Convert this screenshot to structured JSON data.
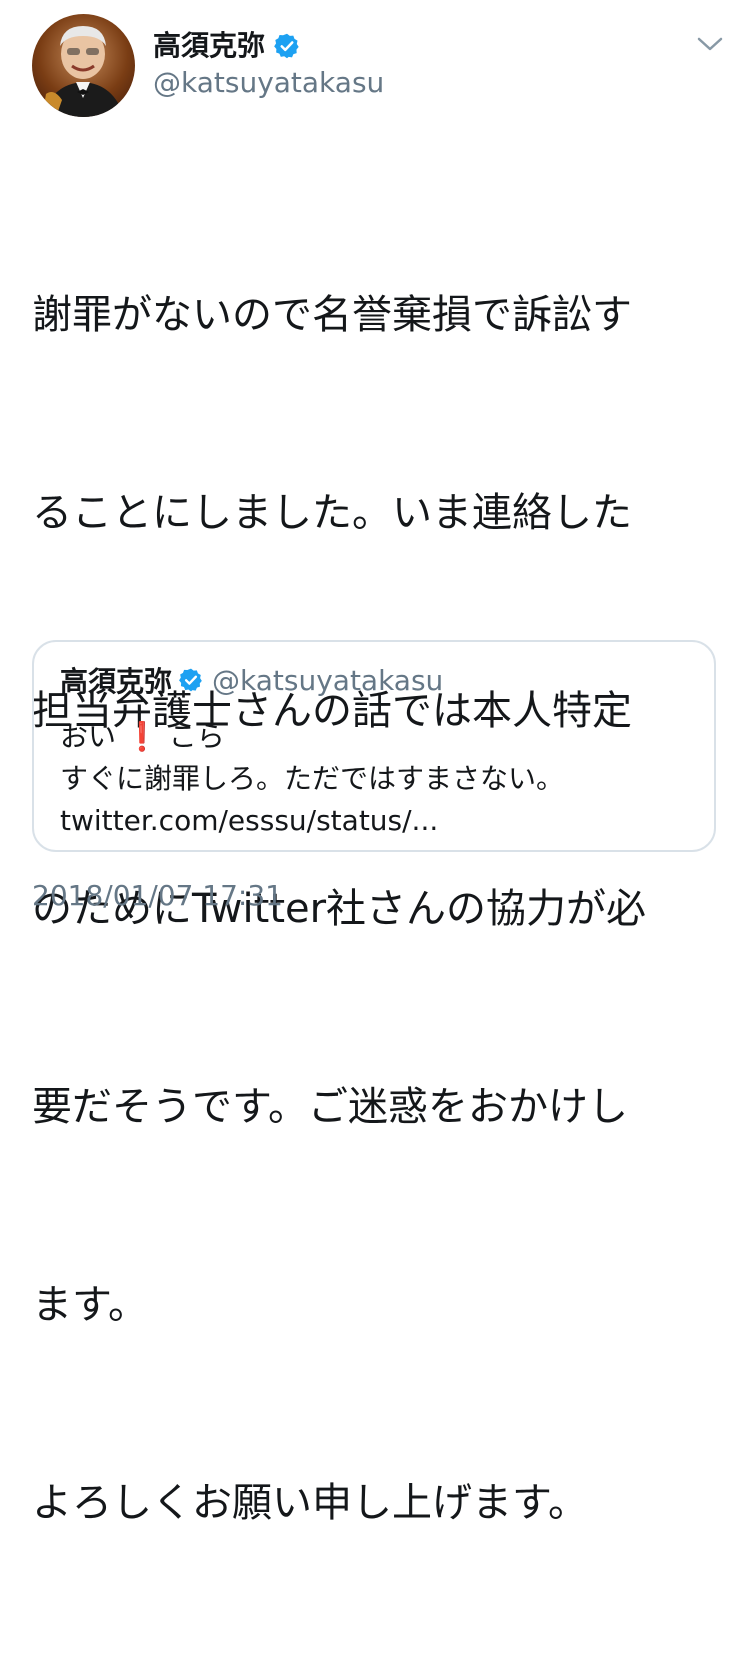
{
  "author": {
    "name": "高須克弥",
    "handle": "@katsuyatakasu",
    "verified": true
  },
  "tweet": {
    "lines": [
      "謝罪がないので名誉棄損で訴訟す",
      "ることにしました。いま連絡した",
      "担当弁護士さんの話では本人特定",
      "のためにTwitter社さんの協力が必",
      "要だそうです。ご迷惑をおかけし",
      "ます。",
      "よろしくお願い申し上げます。"
    ],
    "timestamp": "2018/01/07 17:31"
  },
  "quoted_tweet": {
    "name": "高須克弥",
    "handle": "@katsuyatakasu",
    "line1_start": "おい",
    "line1_emoji": "❗",
    "line1_end": "こら",
    "line2": "すぐに謝罪しろ。ただではすまさない。",
    "line3": "twitter.com/esssu/status/..."
  },
  "icons": {
    "verified": "verified-badge-icon",
    "menu": "chevron-down-icon",
    "avatar": "profile-avatar"
  },
  "colors": {
    "verified": "#1da1f2",
    "muted": "#657786",
    "border": "#d9e1e8",
    "emoji": "#e0242d"
  }
}
